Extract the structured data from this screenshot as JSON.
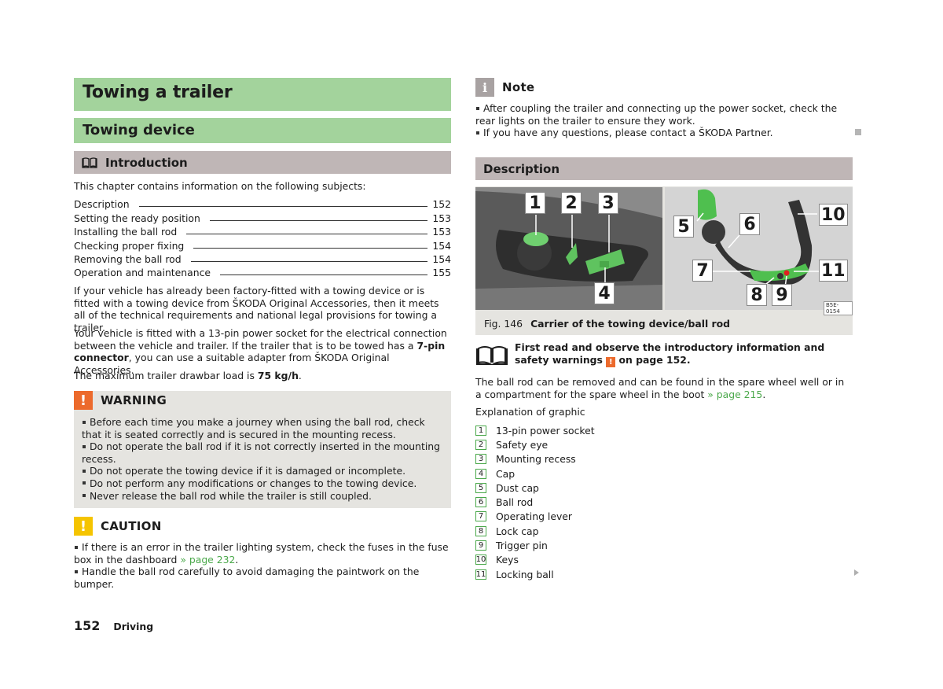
{
  "page": {
    "title": "Towing a trailer",
    "subtitle": "Towing device",
    "page_number": "152",
    "section": "Driving"
  },
  "intro": {
    "heading": "Introduction",
    "lead": "This chapter contains information on the following subjects:",
    "toc": [
      {
        "label": "Description",
        "page": "152"
      },
      {
        "label": "Setting the ready position",
        "page": "153"
      },
      {
        "label": "Installing the ball rod",
        "page": "153"
      },
      {
        "label": "Checking proper fixing",
        "page": "154"
      },
      {
        "label": "Removing the ball rod",
        "page": "154"
      },
      {
        "label": "Operation and maintenance",
        "page": "155"
      }
    ],
    "para1": "If your vehicle has already been factory-fitted with a towing device or is fitted with a towing device from ŠKODA Original Accessories, then it meets all of the technical requirements and national legal provisions for towing a trailer.",
    "para2_a": "Your vehicle is fitted with a 13-pin power socket for the electrical connection be­tween the vehicle and trailer. If the trailer that is to be towed has a ",
    "para2_b": "7-pin connec­tor",
    "para2_c": ", you can use a suitable adapter from ŠKODA Original Accessories.",
    "para3_a": "The maximum trailer drawbar load is ",
    "para3_b": "75 kg/h",
    "para3_c": "."
  },
  "warning": {
    "icon": "!",
    "label": "WARNING",
    "items": [
      "Before each time you make a journey when using the ball rod, check that it is seated correctly and is secured in the mounting recess.",
      "Do not operate the ball rod if it is not correctly inserted in the mounting re­cess.",
      "Do not operate the towing device if it is damaged or incomplete.",
      "Do not perform any modifications or changes to the towing device.",
      "Never release the ball rod while the trailer is still coupled."
    ]
  },
  "caution": {
    "icon": "!",
    "label": "CAUTION",
    "item1_a": "If there is an error in the trailer lighting system, check the fuses in the fuse box in the dashboard ",
    "item1_link": "» page 232",
    "item1_c": ".",
    "item2": "Handle the ball rod carefully to avoid damaging the paintwork on the bumper."
  },
  "note": {
    "icon": "i",
    "label": "Note",
    "items": [
      "After coupling the trailer and connecting up the power socket, check the rear lights on the trailer to ensure they work.",
      "If you have any questions, please contact a ŠKODA Partner."
    ]
  },
  "description": {
    "heading": "Description",
    "figure": {
      "number": "Fig. 146",
      "caption": "Carrier of the towing device/ball rod",
      "code": "B5E-0154",
      "callouts": [
        "1",
        "2",
        "3",
        "4",
        "5",
        "6",
        "7",
        "8",
        "9",
        "10",
        "11"
      ]
    },
    "read_first_a": "First read and observe the introductory information and safety warn­ings ",
    "read_first_icon": "!",
    "read_first_b": " on page 152.",
    "para1_a": "The ball rod can be removed and can be found in the spare wheel well or in a compartment for the spare wheel in the boot ",
    "para1_link": "» page 215",
    "para1_c": ".",
    "legend_title": "Explanation of graphic",
    "legend": [
      {
        "num": "1",
        "label": "13-pin power socket"
      },
      {
        "num": "2",
        "label": "Safety eye"
      },
      {
        "num": "3",
        "label": "Mounting recess"
      },
      {
        "num": "4",
        "label": "Cap"
      },
      {
        "num": "5",
        "label": "Dust cap"
      },
      {
        "num": "6",
        "label": "Ball rod"
      },
      {
        "num": "7",
        "label": "Operating lever"
      },
      {
        "num": "8",
        "label": "Lock cap"
      },
      {
        "num": "9",
        "label": "Trigger pin"
      },
      {
        "num": "10",
        "label": "Keys"
      },
      {
        "num": "11",
        "label": "Locking ball"
      }
    ]
  },
  "colors": {
    "heading_green": "#a3d39c",
    "heading_grey": "#bfb6b6",
    "warning_orange": "#ec6a2c",
    "caution_yellow": "#f5c400",
    "link_green": "#4aa84a",
    "box_grey": "#e5e4e0"
  }
}
